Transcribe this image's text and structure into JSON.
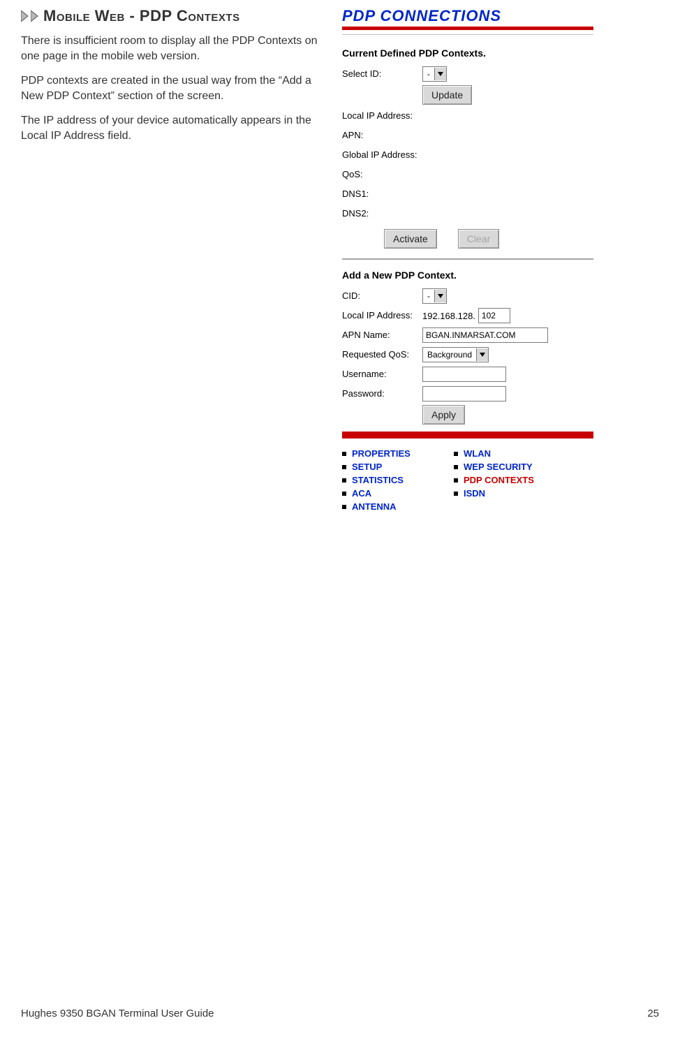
{
  "doc": {
    "heading": "Mobile Web - PDP Contexts",
    "p1": "There is insufficient room to display all the PDP Contexts on one page in the mobile web version.",
    "p2": "PDP contexts are created in the usual way from the “Add a New PDP Context” section of the screen.",
    "p3": "The IP address of your device automatically appears in the Local IP Address field."
  },
  "ss": {
    "title": "PDP CONNECTIONS",
    "section1_title": "Current Defined PDP Contexts.",
    "select_id_label": "Select ID:",
    "select_id_value": "-",
    "update_label": "Update",
    "fields": {
      "local_ip": "Local IP Address:",
      "apn": "APN:",
      "global_ip": "Global IP Address:",
      "qos": "QoS:",
      "dns1": "DNS1:",
      "dns2": "DNS2:"
    },
    "activate_label": "Activate",
    "clear_label": "Clear",
    "section2_title": "Add a New PDP Context.",
    "add": {
      "cid_label": "CID:",
      "cid_value": "-",
      "local_ip_label": "Local IP Address:",
      "local_ip_prefix": "192.168.128.",
      "local_ip_last": "102",
      "apn_name_label": "APN Name:",
      "apn_name_value": "BGAN.INMARSAT.COM",
      "req_qos_label": "Requested QoS:",
      "req_qos_value": "Background",
      "username_label": "Username:",
      "username_value": "",
      "password_label": "Password:",
      "password_value": "",
      "apply_label": "Apply"
    }
  },
  "nav": {
    "col1": [
      "PROPERTIES",
      "SETUP",
      "STATISTICS",
      "ACA",
      "ANTENNA"
    ],
    "col2": [
      "WLAN",
      "WEP SECURITY",
      "PDP CONTEXTS",
      "ISDN"
    ],
    "active": "PDP CONTEXTS"
  },
  "footer": {
    "left": "Hughes 9350 BGAN Terminal User Guide",
    "right": "25"
  }
}
